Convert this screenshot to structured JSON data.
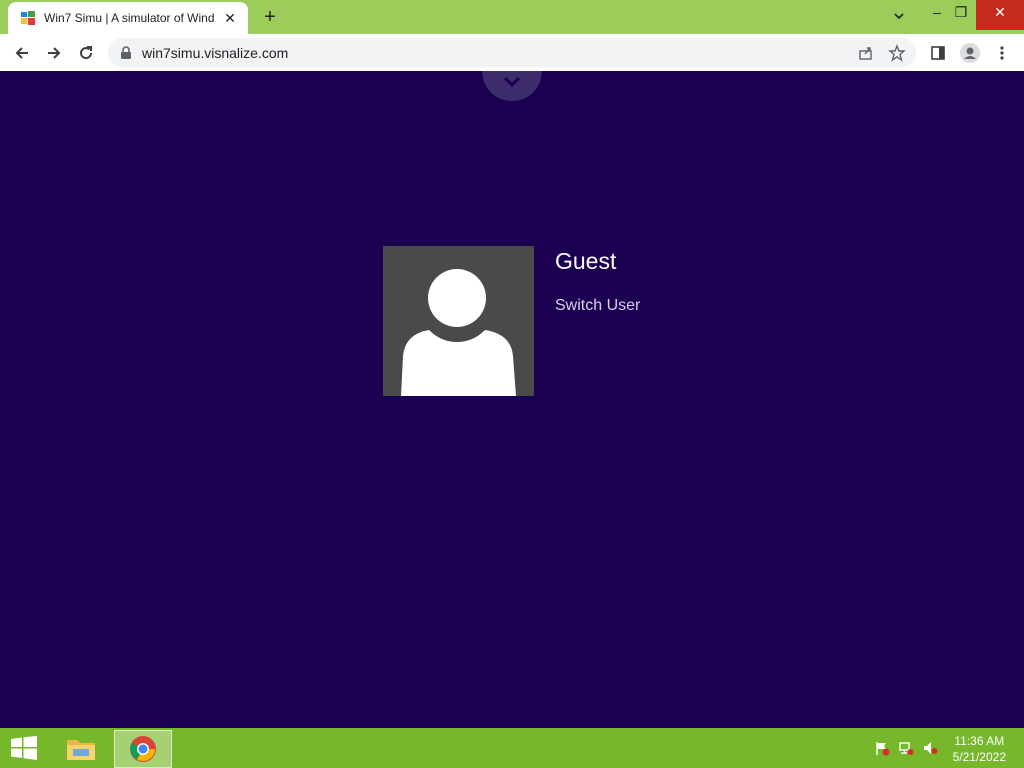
{
  "browser": {
    "tab_title": "Win7 Simu | A simulator of Wind",
    "tab_close": "✕",
    "new_tab": "+",
    "url": "win7simu.visnalize.com"
  },
  "window_controls": {
    "minimize": "–",
    "restore": "❐",
    "close": "✕"
  },
  "login": {
    "user_name": "Guest",
    "switch_user_label": "Switch User"
  },
  "taskbar": {
    "time": "11:36 AM",
    "date": "5/21/2022"
  },
  "colors": {
    "page_bg": "#1b0052",
    "tab_strip": "#9ccc5a",
    "taskbar": "#76b82a",
    "avatar_bg": "#4a4a4a"
  }
}
